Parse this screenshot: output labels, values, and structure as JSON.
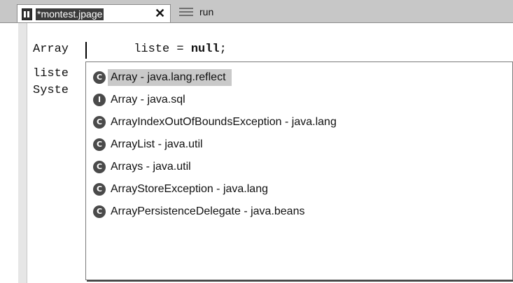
{
  "tabs": {
    "active": {
      "title": "*montest.jpage",
      "close_glyph": "✕",
      "icon": "document-icon"
    },
    "inactive": {
      "title": "run",
      "icon": "list-icon"
    }
  },
  "editor": {
    "lines": [
      {
        "prefix": "Array",
        "rest": " liste = ",
        "keyword": "null",
        "end": ";"
      },
      {
        "text": "liste"
      },
      {
        "text": "Syste"
      }
    ]
  },
  "autocomplete": {
    "selected_index": 0,
    "items": [
      {
        "kind": "C",
        "label": "Array - java.lang.reflect"
      },
      {
        "kind": "I",
        "label": "Array - java.sql"
      },
      {
        "kind": "C",
        "label": "ArrayIndexOutOfBoundsException - java.lang"
      },
      {
        "kind": "C",
        "label": "ArrayList - java.util"
      },
      {
        "kind": "C",
        "label": "Arrays - java.util"
      },
      {
        "kind": "C",
        "label": "ArrayStoreException - java.lang"
      },
      {
        "kind": "C",
        "label": "ArrayPersistenceDelegate - java.beans"
      }
    ]
  }
}
